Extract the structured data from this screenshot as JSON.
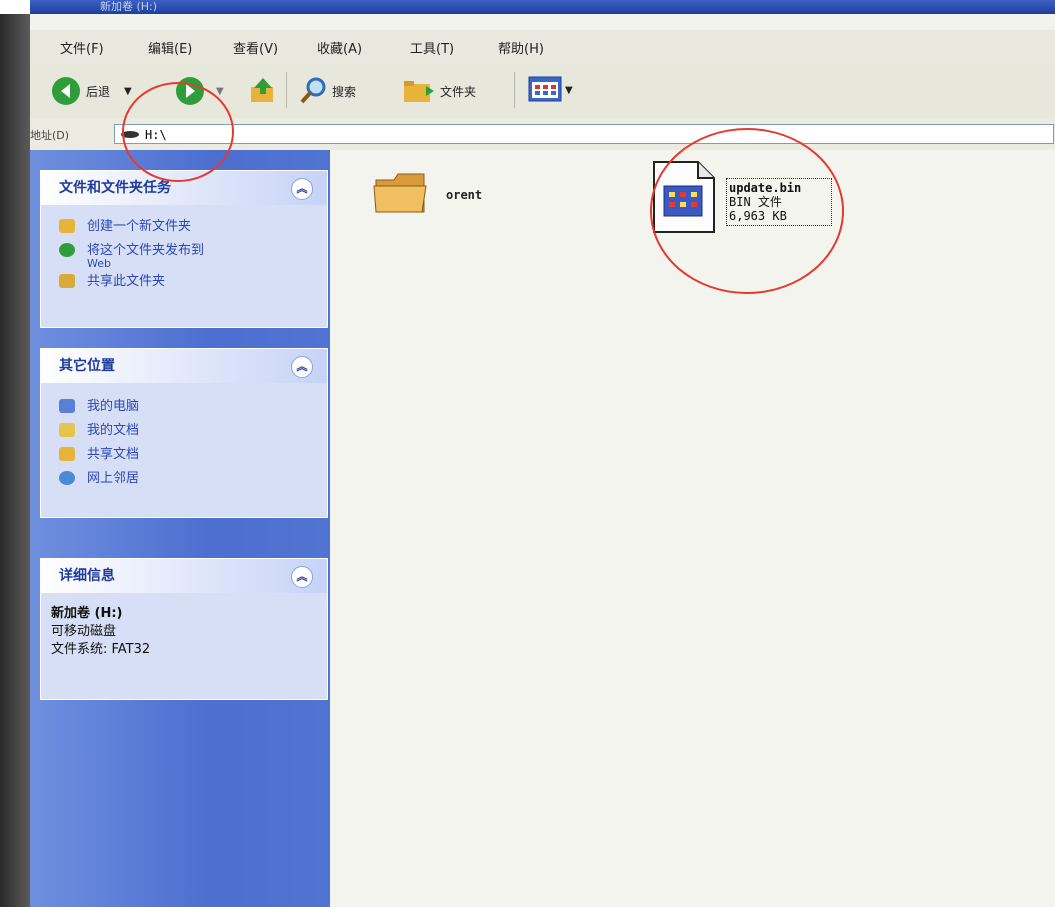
{
  "window": {
    "title": "新加卷 (H:)"
  },
  "menu": [
    "文件(F)",
    "编辑(E)",
    "查看(V)",
    "收藏(A)",
    "工具(T)",
    "帮助(H)"
  ],
  "toolbar": {
    "back_label": "后退",
    "search_label": "搜索",
    "folders_label": "文件夹"
  },
  "address": {
    "label": "地址(D)",
    "value": "H:\\"
  },
  "tasks": {
    "title": "文件和文件夹任务",
    "items": [
      "创建一个新文件夹",
      "将这个文件夹发布到",
      "共享此文件夹"
    ],
    "web": "Web"
  },
  "places": {
    "title": "其它位置",
    "items": [
      "我的电脑",
      "我的文档",
      "共享文档",
      "网上邻居"
    ]
  },
  "details": {
    "title": "详细信息",
    "volume": "新加卷 (H:)",
    "type": "可移动磁盘",
    "fs": "文件系统: FAT32"
  },
  "files": [
    {
      "name": "orent",
      "kind": "folder"
    },
    {
      "name": "update.bin",
      "type": "BIN 文件",
      "size": "6,963 KB"
    }
  ]
}
